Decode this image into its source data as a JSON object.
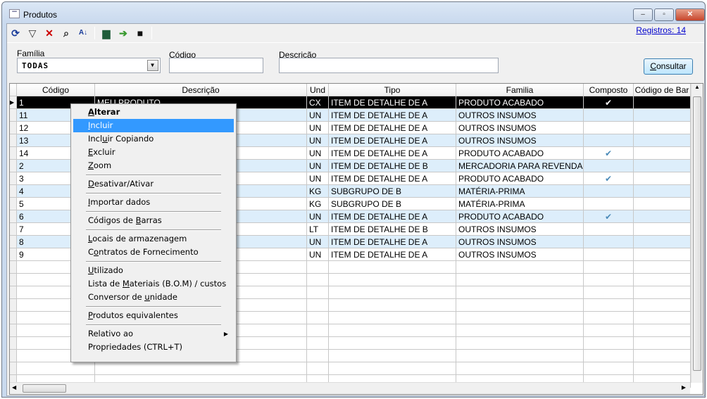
{
  "window": {
    "title": "Produtos",
    "minimize": "–",
    "maximize": "▫",
    "close": "✕"
  },
  "toolbar": {
    "icons": [
      "refresh-icon",
      "filter-icon",
      "clear-filter-icon",
      "search-icon",
      "sort-az-icon",
      "print-icon",
      "export-icon",
      "save-icon"
    ],
    "records": "Registros: 14"
  },
  "filters": {
    "familia_label": "Família",
    "familia_value": "TODAS",
    "codigo_label": "Código",
    "codigo_value": "",
    "descricao_label": "Descrição",
    "descricao_value": "",
    "consultar": "Consultar"
  },
  "grid": {
    "columns": [
      "Código",
      "Descrição",
      "Und",
      "Tipo",
      "Familia",
      "Composto",
      "Código de Bar"
    ],
    "rows": [
      {
        "codigo": "1",
        "descricao": "MEU PRODUTO",
        "und": "CX",
        "tipo": "ITEM DE DETALHE DE A",
        "familia": "PRODUTO ACABADO",
        "composto": true,
        "selected": true
      },
      {
        "codigo": "11",
        "descricao": "",
        "und": "UN",
        "tipo": "ITEM DE DETALHE DE A",
        "familia": "OUTROS INSUMOS",
        "composto": false
      },
      {
        "codigo": "12",
        "descricao": "",
        "und": "UN",
        "tipo": "ITEM DE DETALHE DE A",
        "familia": "OUTROS INSUMOS",
        "composto": false
      },
      {
        "codigo": "13",
        "descricao": "",
        "und": "UN",
        "tipo": "ITEM DE DETALHE DE A",
        "familia": "OUTROS INSUMOS",
        "composto": false
      },
      {
        "codigo": "14",
        "descricao": "",
        "und": "UN",
        "tipo": "ITEM DE DETALHE DE A",
        "familia": "PRODUTO ACABADO",
        "composto": true
      },
      {
        "codigo": "2",
        "descricao": "",
        "und": "UN",
        "tipo": "ITEM DE DETALHE DE B",
        "familia": "MERCADORIA PARA REVENDA",
        "composto": false
      },
      {
        "codigo": "3",
        "descricao": "",
        "und": "UN",
        "tipo": "ITEM DE DETALHE DE A",
        "familia": "PRODUTO ACABADO",
        "composto": true
      },
      {
        "codigo": "4",
        "descricao": "",
        "und": "KG",
        "tipo": "SUBGRUPO DE B",
        "familia": "MATÉRIA-PRIMA",
        "composto": false
      },
      {
        "codigo": "5",
        "descricao": "",
        "und": "KG",
        "tipo": "SUBGRUPO DE B",
        "familia": "MATÉRIA-PRIMA",
        "composto": false
      },
      {
        "codigo": "6",
        "descricao": "",
        "und": "UN",
        "tipo": "ITEM DE DETALHE DE A",
        "familia": "PRODUTO ACABADO",
        "composto": true
      },
      {
        "codigo": "7",
        "descricao": "",
        "und": "LT",
        "tipo": "ITEM DE DETALHE DE B",
        "familia": "OUTROS INSUMOS",
        "composto": false
      },
      {
        "codigo": "8",
        "descricao": "",
        "und": "UN",
        "tipo": "ITEM DE DETALHE DE A",
        "familia": "OUTROS INSUMOS",
        "composto": false
      },
      {
        "codigo": "9",
        "descricao": "",
        "und": "UN",
        "tipo": "ITEM DE DETALHE DE A",
        "familia": "OUTROS INSUMOS",
        "composto": false
      }
    ]
  },
  "context_menu": [
    {
      "label": "Alterar",
      "u": 0,
      "bold": true
    },
    {
      "label": "Incluir",
      "u": 0,
      "highlighted": true
    },
    {
      "label": "Incluir Copiando",
      "u": 4
    },
    {
      "label": "Excluir",
      "u": 0
    },
    {
      "label": "Zoom",
      "u": 0
    },
    {
      "separator": true
    },
    {
      "label": "Desativar/Ativar",
      "u": 0
    },
    {
      "separator": true
    },
    {
      "label": "Importar dados",
      "u": 0
    },
    {
      "separator": true
    },
    {
      "label": "Códigos de Barras",
      "u": 11
    },
    {
      "separator": true
    },
    {
      "label": "Locais de armazenagem",
      "u": 0
    },
    {
      "label": "Contratos de Fornecimento",
      "u": 1
    },
    {
      "separator": true
    },
    {
      "label": "Utilizado",
      "u": 0
    },
    {
      "label": "Lista de Materiais (B.O.M) / custos",
      "u": 9
    },
    {
      "label": "Conversor de unidade",
      "u": 13
    },
    {
      "separator": true
    },
    {
      "label": "Produtos equivalentes",
      "u": 0
    },
    {
      "separator": true
    },
    {
      "label": "Relativo ao",
      "submenu": true
    },
    {
      "label": "Propriedades (CTRL+T)"
    }
  ]
}
